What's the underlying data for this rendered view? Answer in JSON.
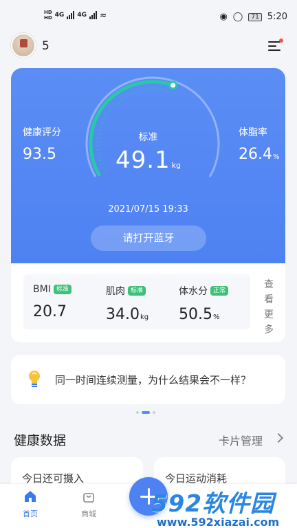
{
  "status_bar": {
    "left_hd_top": "HD",
    "left_hd_bottom": "HD",
    "network_1": "4G",
    "network_2": "4G",
    "battery": "71",
    "time": "5:20"
  },
  "header": {
    "count": "5"
  },
  "hero": {
    "health_score_label": "健康评分",
    "health_score_value": "93.5",
    "gauge_label": "标准",
    "weight_value": "49.1",
    "weight_unit": "kg",
    "body_fat_label": "体脂率",
    "body_fat_value": "26.4",
    "body_fat_unit": "%",
    "datetime": "2021/07/15 19:33",
    "bluetooth_button": "请打开蓝牙",
    "gauge_progress": 0.58
  },
  "metrics": {
    "items": [
      {
        "label": "BMI",
        "badge": "标准",
        "value": "20.7",
        "unit": ""
      },
      {
        "label": "肌肉",
        "badge": "标准",
        "value": "34.0",
        "unit": "kg"
      },
      {
        "label": "体水分",
        "badge": "正常",
        "value": "50.5",
        "unit": "%"
      }
    ],
    "more_label": "查看更多",
    "badge_color": "#3cc07a"
  },
  "tip": {
    "text": "同一时间连续测量，为什么结果会不一样？"
  },
  "section": {
    "title": "健康数据",
    "manage_link": "卡片管理"
  },
  "data_cards": [
    {
      "label": "今日还可摄入"
    },
    {
      "label": "今日运动消耗"
    }
  ],
  "bottom_nav": {
    "home": "首页",
    "shop": "商城"
  },
  "watermark": {
    "logo": "592软件园",
    "url": "www.592xiazai.com"
  },
  "colors": {
    "primary": "#4e82f2",
    "gauge_arc": "#28c9a8",
    "badge_green": "#3cc07a"
  }
}
